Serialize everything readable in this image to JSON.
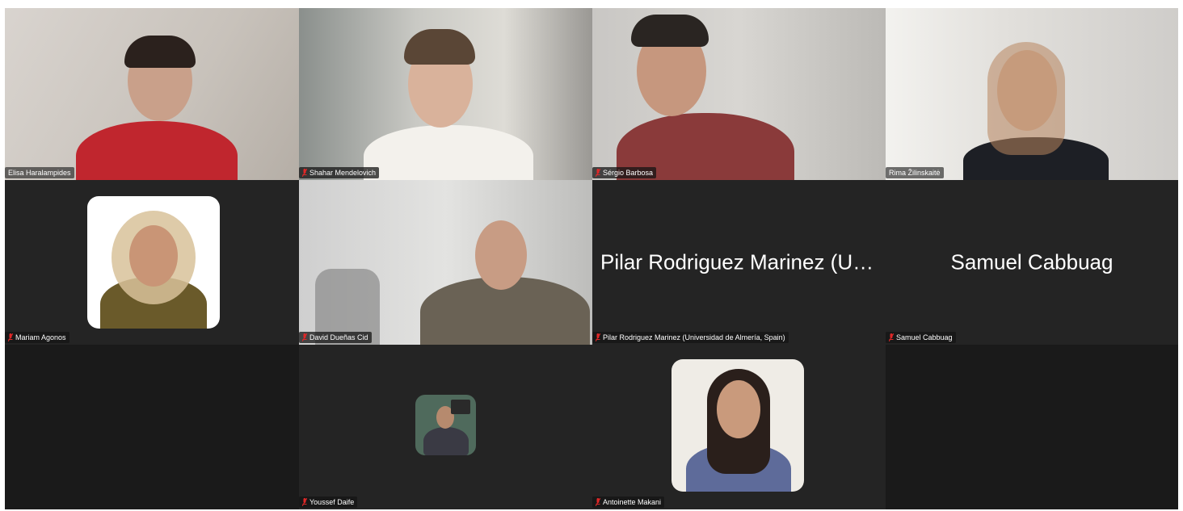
{
  "participants": [
    {
      "name": "Elisa Haralampides",
      "muted": false
    },
    {
      "name": "Shahar Mendelovich",
      "muted": true
    },
    {
      "name": "Sérgio Barbosa",
      "muted": true
    },
    {
      "name": "Rima Žilinskaitė",
      "muted": false,
      "active_speaker": true
    },
    {
      "name": "Mariam Agonos",
      "muted": true
    },
    {
      "name": "David Dueñas Cid",
      "muted": true
    },
    {
      "name": "Pilar Rodriguez Marinez (Universidad de Almería, Spain)",
      "display_name": "Pilar Rodriguez Marinez (Un...",
      "muted": true
    },
    {
      "name": "Samuel Cabbuag",
      "display_name": "Samuel Cabbuag",
      "muted": true
    },
    {
      "name": "Youssef Daife",
      "muted": true
    },
    {
      "name": "Antoinette Makani",
      "muted": true
    }
  ],
  "colors": {
    "tile_bg": "#242424",
    "active_border": "#2ecc40",
    "mute_red": "#e02828"
  },
  "icons": {
    "mute": "muted-microphone-icon"
  }
}
